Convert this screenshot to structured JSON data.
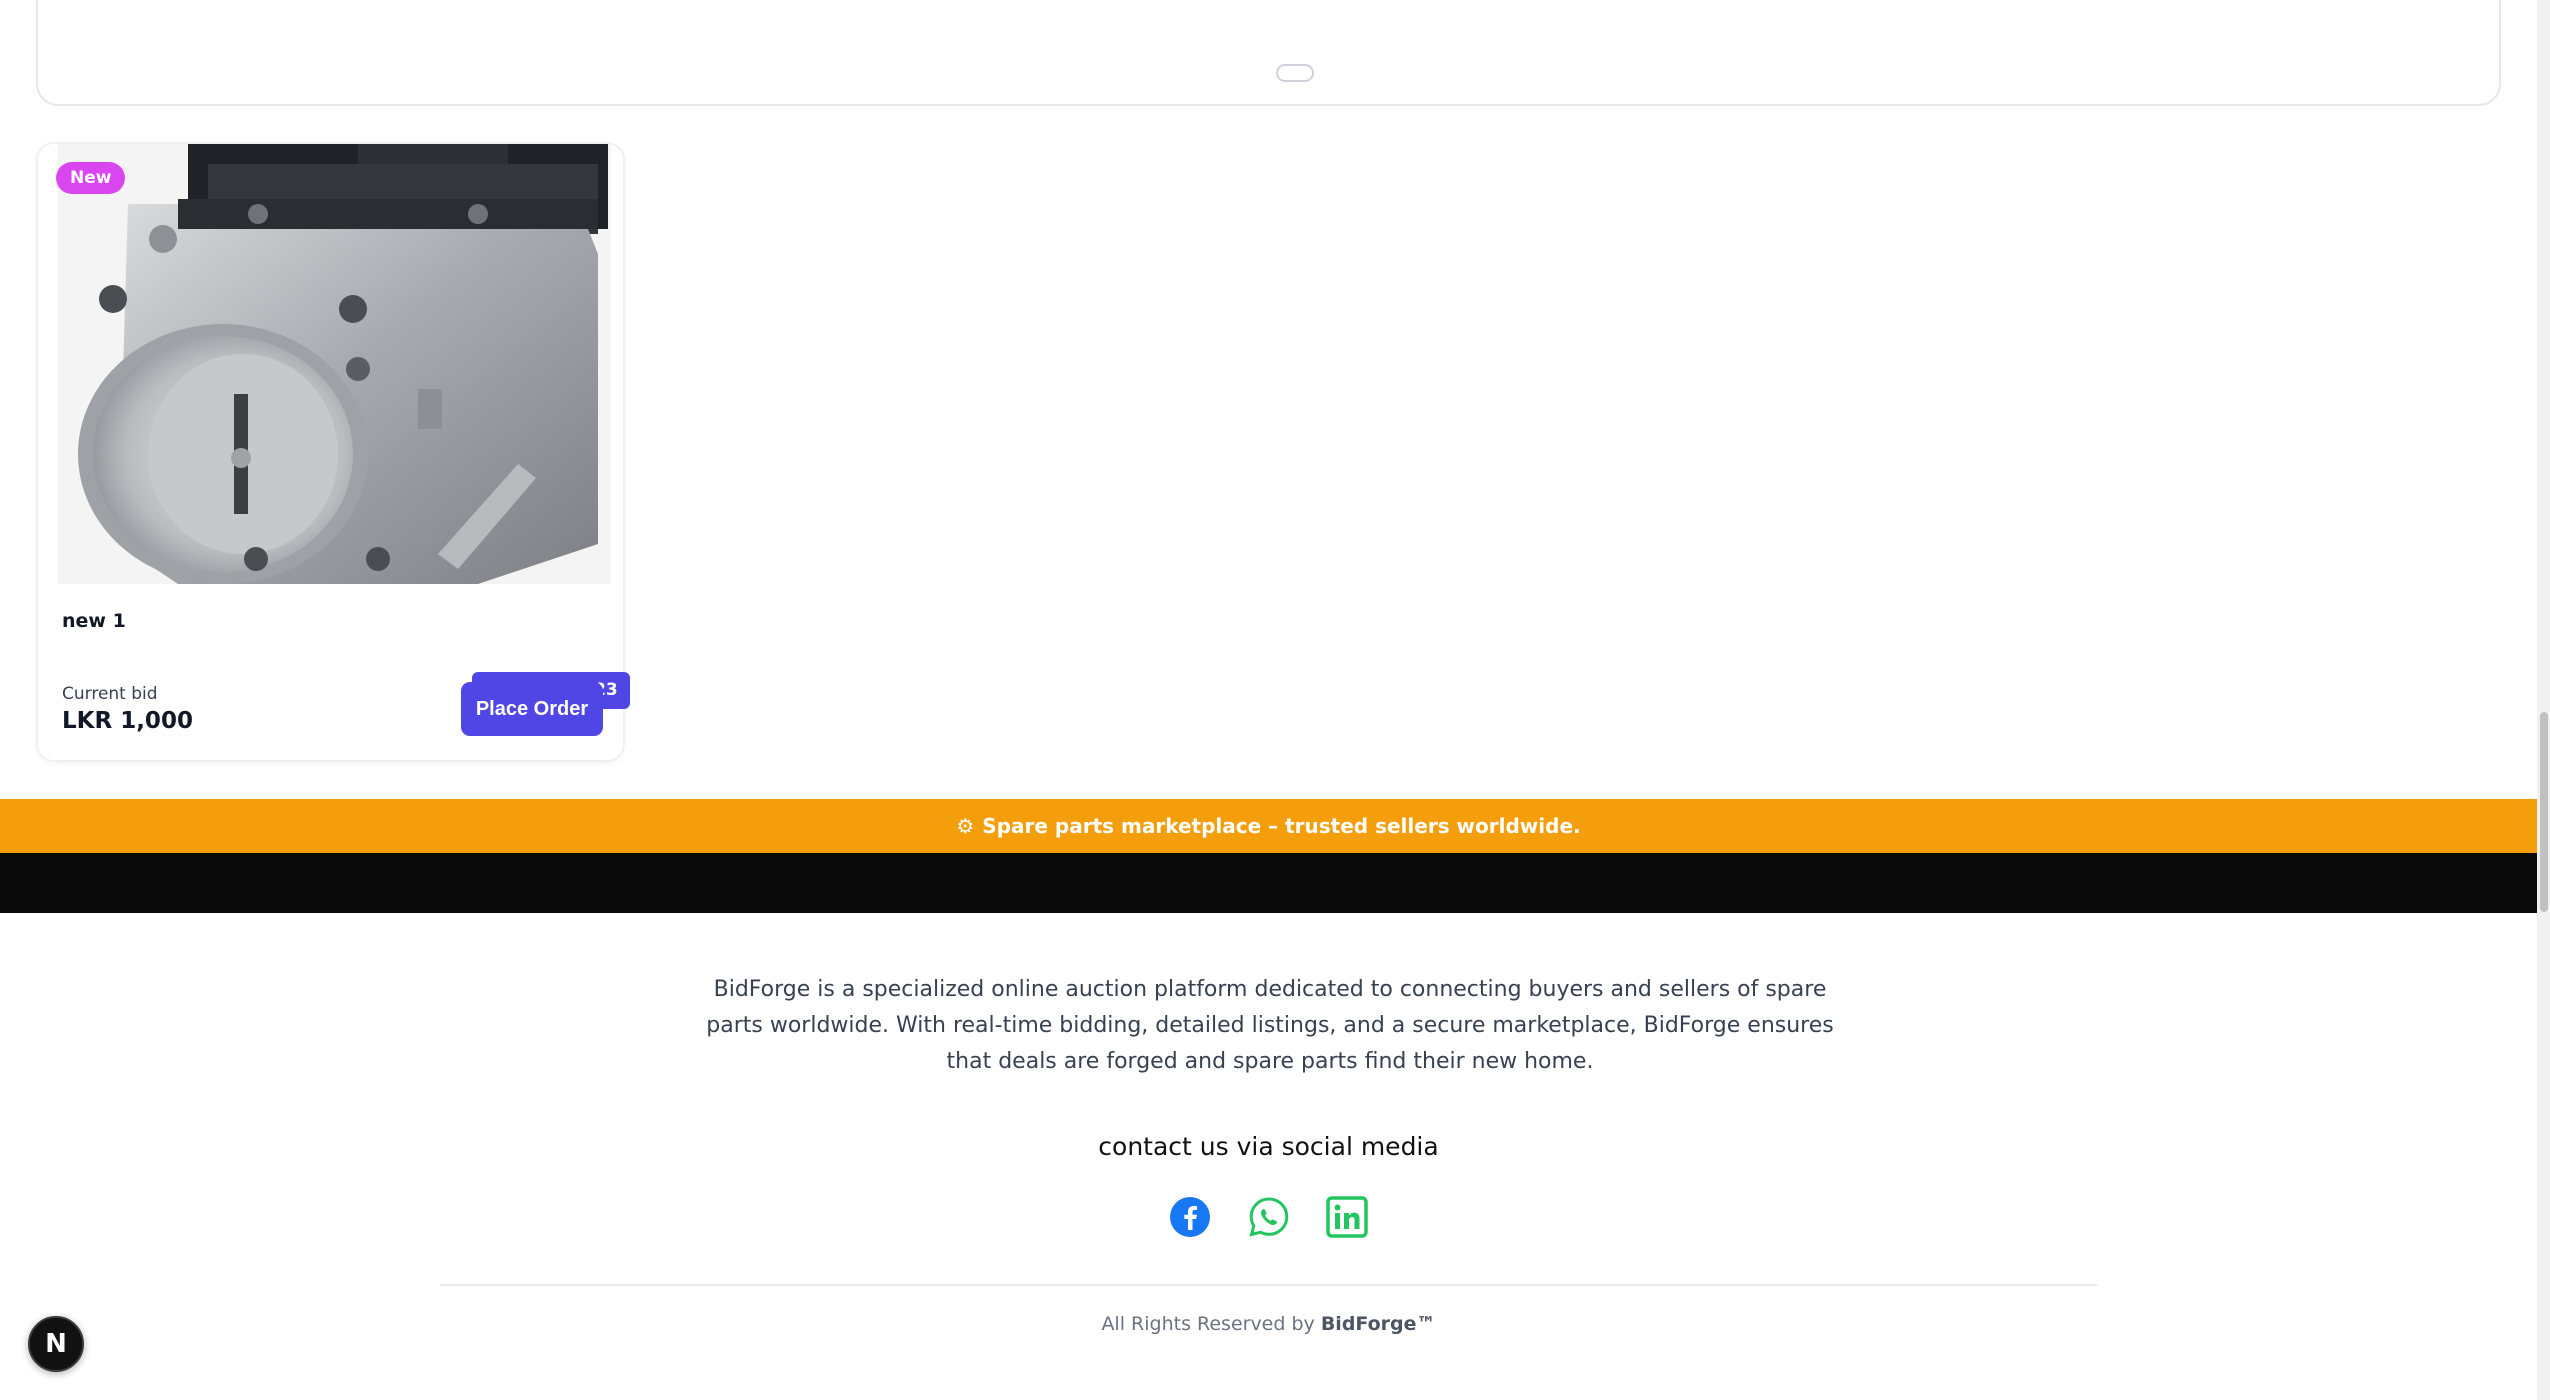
{
  "product": {
    "badge": "New",
    "timer": "6d 20:23:23",
    "title": "new 1",
    "bid_label": "Current bid",
    "bid_value": "LKR 1,000",
    "order_label": "Place Order",
    "image_icon": "throttle-body-image"
  },
  "banner": {
    "text": "Spare parts marketplace – trusted sellers worldwide.",
    "icon": "gear-icon",
    "color": "#f59e0b"
  },
  "footer": {
    "description": "BidForge is a specialized online auction platform dedicated to connecting buyers and sellers of spare parts worldwide. With real-time bidding, detailed listings, and a secure marketplace, BidForge ensures that deals are forged and spare parts find their new home.",
    "contact_title": "contact us via social media",
    "social": [
      "facebook-icon",
      "whatsapp-icon",
      "linkedin-icon"
    ],
    "rights_prefix": "All Rights Reserved by",
    "rights_brand": "BidForge™"
  },
  "dev_button": {
    "label": "N"
  },
  "colors": {
    "primary": "#4f46e5",
    "badge": "#d946ef",
    "banner": "#f59e0b",
    "facebook": "#1877f2",
    "whatsapp": "#22c55e",
    "linkedin": "#22c55e"
  }
}
